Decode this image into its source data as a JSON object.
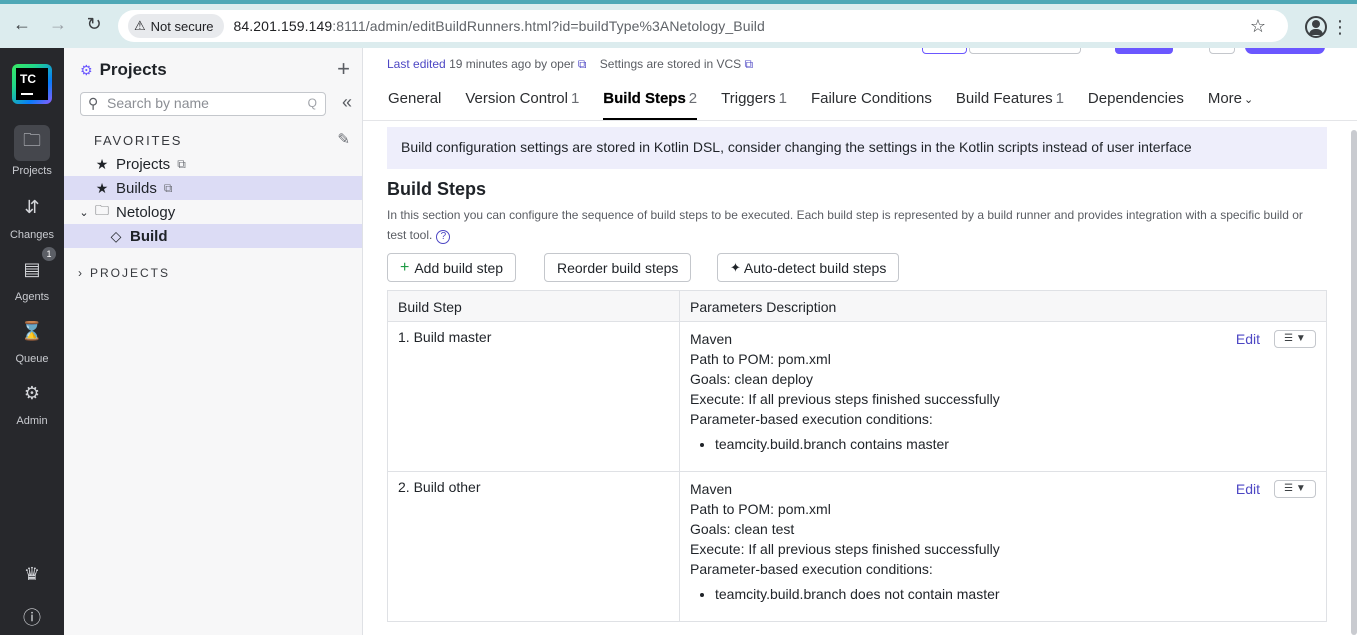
{
  "browser": {
    "security_label": "Not secure",
    "url_host": "84.201.159.149",
    "url_rest": ":8111/admin/editBuildRunners.html?id=buildType%3ANetology_Build"
  },
  "rail": {
    "projects": "Projects",
    "changes": "Changes",
    "agents": "Agents",
    "agents_badge": "1",
    "queue": "Queue",
    "admin": "Admin",
    "logo_text": "TC"
  },
  "sidebar": {
    "title": "Projects",
    "search_placeholder": "Search by name",
    "search_shortcut": "Q",
    "favorites_label": "FAVORITES",
    "items": [
      {
        "label": "Projects"
      },
      {
        "label": "Builds"
      },
      {
        "label": "Netology"
      },
      {
        "label": "Build"
      }
    ],
    "projects_label": "PROJECTS"
  },
  "main": {
    "last_edited_prefix": "Last edited",
    "last_edited_time": "19 minutes ago by",
    "last_edited_user": "oper",
    "vcs_note": "Settings are stored in VCS",
    "tabs": [
      {
        "label": "General",
        "count": ""
      },
      {
        "label": "Version Control",
        "count": "1"
      },
      {
        "label": "Build Steps",
        "count": "2"
      },
      {
        "label": "Triggers",
        "count": "1"
      },
      {
        "label": "Failure Conditions",
        "count": ""
      },
      {
        "label": "Build Features",
        "count": "1"
      },
      {
        "label": "Dependencies",
        "count": ""
      },
      {
        "label": "More",
        "count": ""
      }
    ],
    "dsl_note": "Build configuration settings are stored in Kotlin DSL, consider changing the settings in the Kotlin scripts instead of user interface",
    "heading": "Build Steps",
    "description": "In this section you can configure the sequence of build steps to be executed. Each build step is represented by a build runner and provides integration with a specific build or test tool.",
    "buttons": {
      "add": "Add build step",
      "reorder": "Reorder build steps",
      "autodetect": "Auto-detect build steps"
    },
    "table": {
      "col_step": "Build Step",
      "col_params": "Parameters Description",
      "edit_label": "Edit",
      "rows": [
        {
          "name": "1. Build master",
          "runner": "Maven",
          "pom": "Path to POM: pom.xml",
          "goals": "Goals: clean deploy",
          "execute": "Execute: If all previous steps finished successfully",
          "conditions_label": "Parameter-based execution conditions:",
          "condition": "teamcity.build.branch contains master"
        },
        {
          "name": "2. Build other",
          "runner": "Maven",
          "pom": "Path to POM: pom.xml",
          "goals": "Goals: clean test",
          "execute": "Execute: If all previous steps finished successfully",
          "conditions_label": "Parameter-based execution conditions:",
          "condition": "teamcity.build.branch does not contain master"
        }
      ]
    }
  }
}
